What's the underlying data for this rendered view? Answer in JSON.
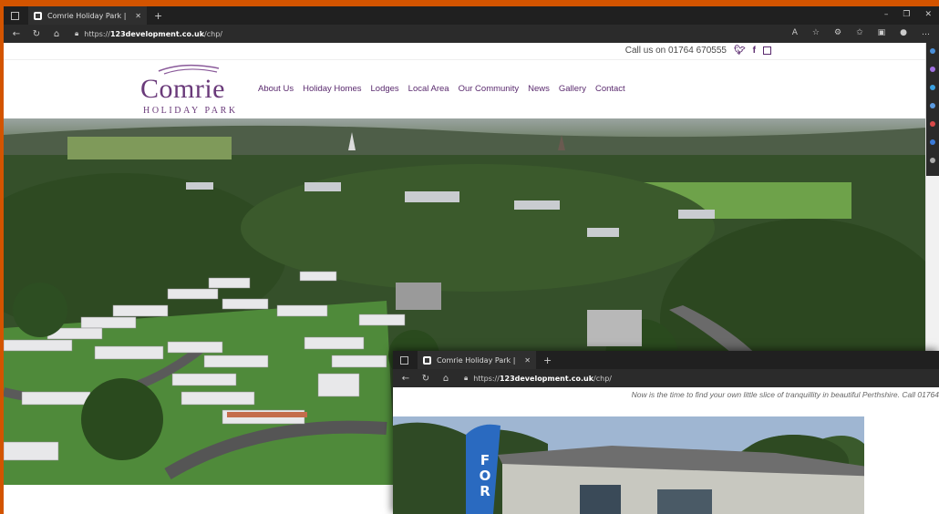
{
  "browser": {
    "tab_title": "Comrie Holiday Park |",
    "url_host": "123development.co.uk",
    "url_prefix": "https://",
    "url_path": "/chp/"
  },
  "site": {
    "call_text": "Call us on 01764 670555",
    "logo_name": "Comrie",
    "logo_sub": "HOLIDAY PARK",
    "menu": [
      "About Us",
      "Holiday Homes",
      "Lodges",
      "Local Area",
      "Our Community",
      "News",
      "Gallery",
      "Contact"
    ],
    "tagline": "Now is the time to find your own little slice of tranquillit",
    "colors": {
      "brand": "#6a3a7a",
      "frame": "#d35400"
    }
  },
  "second_window": {
    "tab_title": "Comrie Holiday Park |",
    "url_host": "123development.co.uk",
    "url_prefix": "https://",
    "url_path": "/chp/",
    "tagline": "Now is the time to find your own little slice of tranquillity in beautiful Perthshire. Call 01764",
    "flag_letters": [
      "F",
      "O",
      "R"
    ]
  }
}
